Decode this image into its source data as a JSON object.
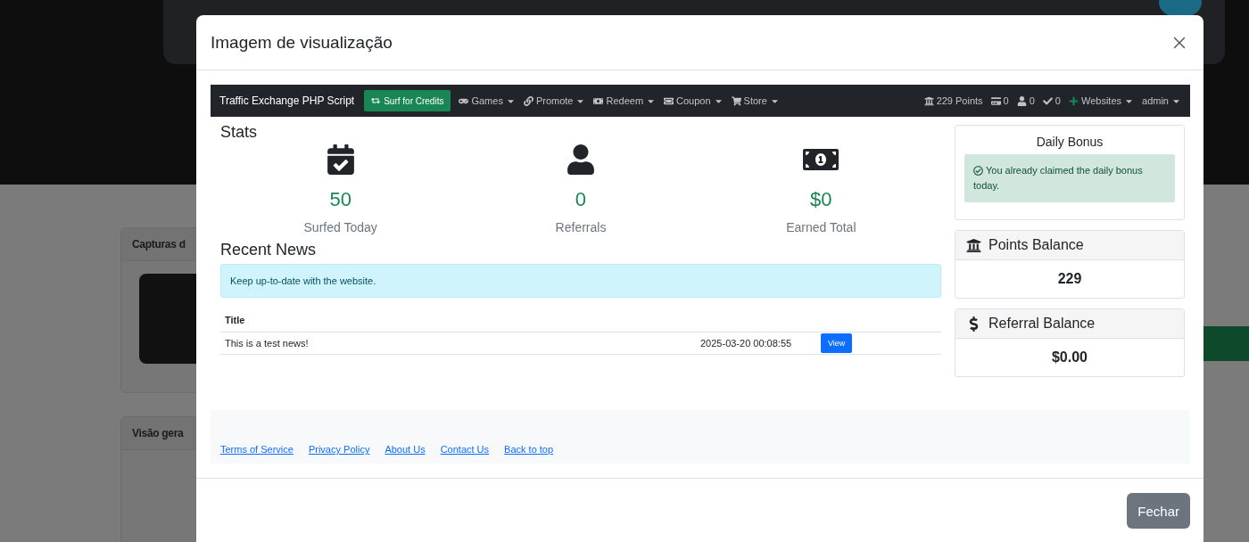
{
  "backdrop": {
    "cards": [
      {
        "title": "Capturas d",
        "kind": "screenshot"
      },
      {
        "title": "Visão gera",
        "kind": "chart"
      }
    ]
  },
  "modal": {
    "title": "Imagem de visualização",
    "close_button": "Fechar"
  },
  "preview": {
    "navbar": {
      "brand": "Traffic Exchange PHP Script",
      "surf_button": "Surf for Credits",
      "menus": [
        {
          "label": "Games",
          "kind": "gamepad"
        },
        {
          "label": "Promote",
          "kind": "link"
        },
        {
          "label": "Redeem",
          "kind": "cash"
        },
        {
          "label": "Coupon",
          "kind": "ticket"
        },
        {
          "label": "Store",
          "kind": "cart"
        }
      ],
      "counters": [
        {
          "label": "229 Points",
          "kind": "bank"
        },
        {
          "label": "0",
          "kind": "card"
        },
        {
          "label": "0",
          "kind": "user"
        },
        {
          "label": "0",
          "kind": "check"
        }
      ],
      "websites": "Websites",
      "user": "admin"
    },
    "stats": {
      "title": "Stats",
      "items": [
        {
          "value": "50",
          "label": "Surfed Today",
          "kind": "calendar"
        },
        {
          "value": "0",
          "label": "Referrals",
          "kind": "user"
        },
        {
          "value": "$0",
          "label": "Earned Total",
          "kind": "money"
        }
      ]
    },
    "news": {
      "title": "Recent News",
      "alert": "Keep up-to-date with the website.",
      "columns": [
        "Title"
      ],
      "rows": [
        {
          "title": "This is a test news!",
          "date": "2025-03-20 00:08:55",
          "action": "View"
        }
      ]
    },
    "daily_bonus": {
      "title": "Daily Bonus",
      "message": "You already claimed the daily bonus today."
    },
    "balances": [
      {
        "title": "Points Balance",
        "value": "229",
        "kind": "bank"
      },
      {
        "title": "Referral Balance",
        "value": "$0.00",
        "kind": "dollar"
      }
    ],
    "footer_links": [
      "Terms of Service",
      "Privacy Policy",
      "About Us",
      "Contact Us",
      "Back to top"
    ]
  }
}
